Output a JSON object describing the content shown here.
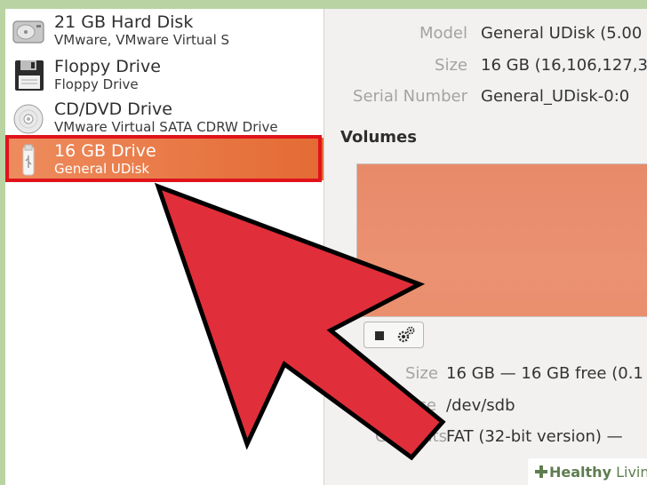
{
  "drives": [
    {
      "name": "21 GB Hard Disk",
      "description": "VMware, VMware Virtual S",
      "icon": "hard-disk-icon",
      "selected": false
    },
    {
      "name": "Floppy Drive",
      "description": "Floppy Drive",
      "icon": "floppy-icon",
      "selected": false
    },
    {
      "name": "CD/DVD Drive",
      "description": "VMware Virtual SATA CDRW Drive",
      "icon": "optical-disc-icon",
      "selected": false
    },
    {
      "name": "16 GB Drive",
      "description": "General UDisk",
      "icon": "usb-drive-icon",
      "selected": true
    }
  ],
  "properties": {
    "model_label": "Model",
    "model_value": "General UDisk (5.00",
    "size_label": "Size",
    "size_value": "16 GB (16,106,127,3",
    "serial_label": "Serial Number",
    "serial_value": "General_UDisk-0:0"
  },
  "volumes": {
    "title": "Volumes",
    "size_label": "Size",
    "size_value": "16 GB — 16 GB free (0.1",
    "device_label": "ice",
    "device_value": "/dev/sdb",
    "contents_label": "Contents",
    "contents_value": "FAT (32-bit version) —"
  },
  "colors": {
    "selection": "#e8743f",
    "highlight_box": "#e0131b",
    "arrow_fill": "#e02f3a",
    "volume_fill": "#e98c6c"
  },
  "watermark": {
    "part1": "Healthy",
    "part2": " Living"
  }
}
